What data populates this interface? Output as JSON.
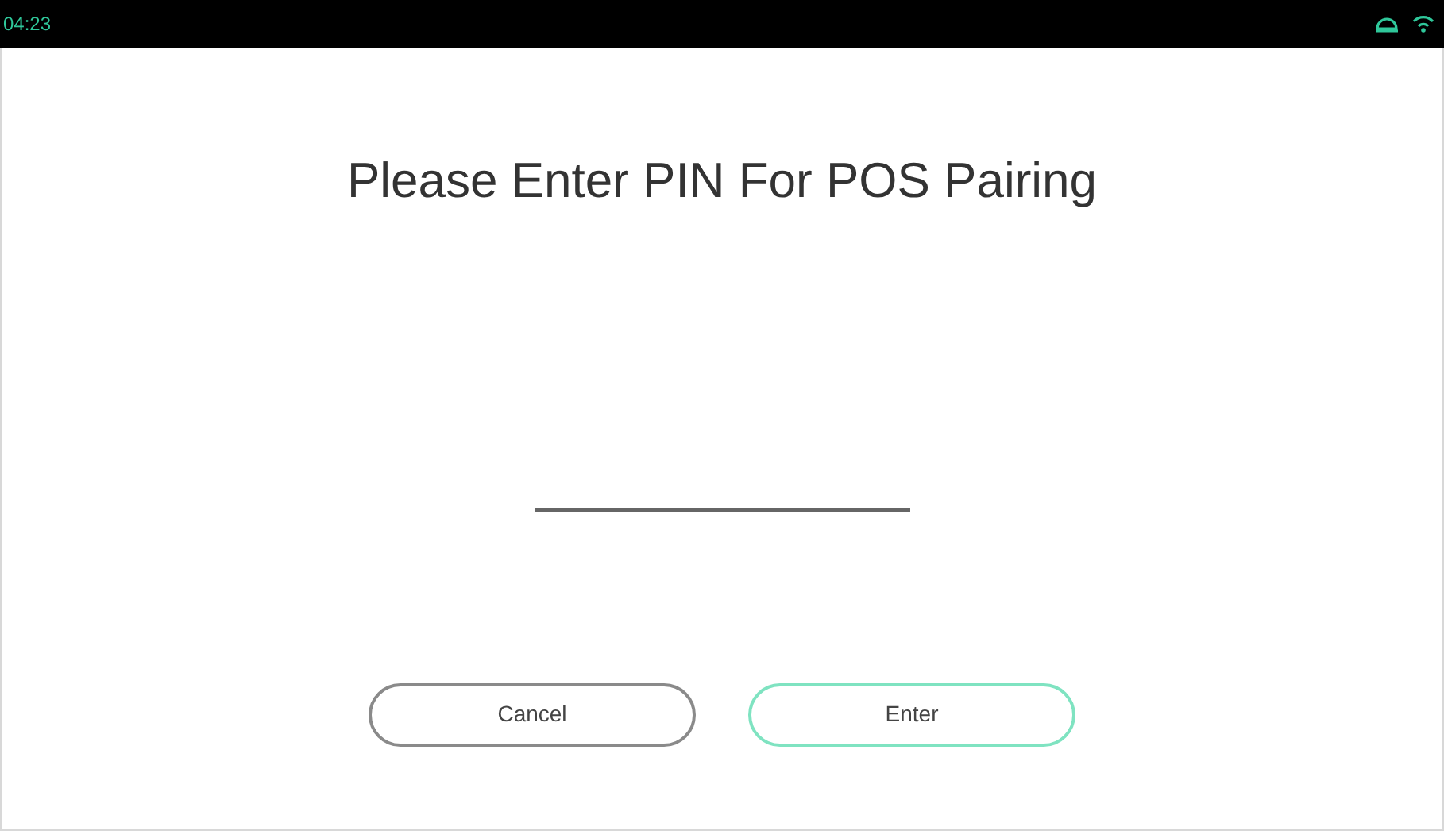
{
  "status_bar": {
    "time": "04:23"
  },
  "title": "Please Enter PIN For POS Pairing",
  "buttons": [
    {
      "label": "Cancel",
      "kind": "secondary"
    },
    {
      "label": "Enter",
      "kind": "primary"
    }
  ]
}
